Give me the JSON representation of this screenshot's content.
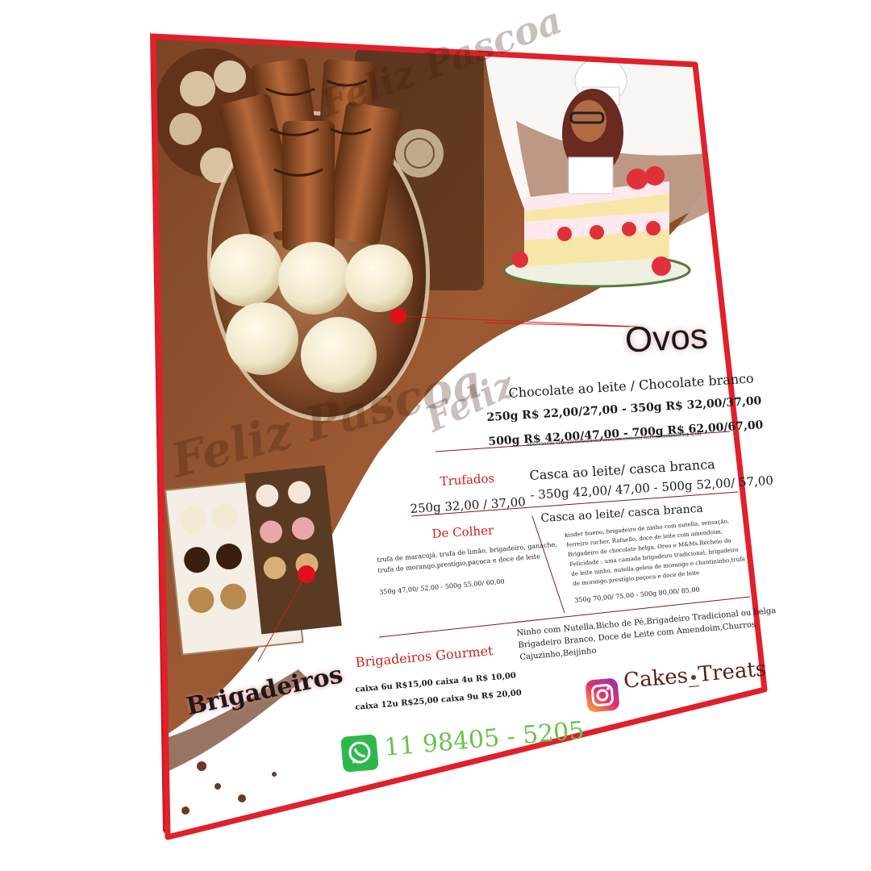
{
  "ovos": {
    "title": "Ovos",
    "subtitle": "Chocolate ao leite / Chocolate branco",
    "line1": "250g  R$ 22,00/27,00 - 350g R$ 32,00/37,00",
    "line2": "500g  R$ 42,00/47,00  - 700g R$ 62,00/67,00",
    "obs": "obs: cascas crocantes(bolacha oreo,amendoim) acrescentamos R$ 8,00"
  },
  "trufados": {
    "title": "Trufados",
    "subtitle": "Casca ao leite/ casca branca",
    "line1": "250g 32,00 / 37,00",
    "line2": "- 350g 42,00/ 47,00 - 500g 52,00/ 57,00"
  },
  "de_colher": {
    "title": "De Colher",
    "flavors": "trufa de maracujá, trufa de limão, brigadeiro, ganache,",
    "flavors2": "trufa de morango,prestígio,paçoca e doce de leite",
    "prices": "350g 47,00/ 52,00  -   500g 55,00/ 60,00"
  },
  "especial": {
    "subtitle": "Casca ao leite/ casca branca",
    "fl1": "kinder bueno, brigadeiro de ninho com nutella, sensação,",
    "fl2": "ferreiro rocher, Rafaello, doce de leite com amendoim,",
    "fl3": "Brigadeiro de chocolate belga, Oreo e M&Ms.Recheio da",
    "fl4": "Felicidade : uma camada brigadeiro tradicional, brigadeiro",
    "fl5": "de leite ninho, nutella,geleia de morango e chantininho,trufa",
    "fl6": "de morango,prestígio,paçoca e doce de leite",
    "prices": "350g 70,00/ 75,00   -   500g 80,00/ 85,00"
  },
  "brigadeiros": {
    "title": "Brigadeiros",
    "gourmet_title": "Brigadeiros Gourmet",
    "line1": "caixa 6u  R$15,00 caixa 4u R$ 10,00",
    "line2": "caixa 12u R$25,00 caixa 9u R$ 20,00",
    "flavors1": "Ninho com Nutella,Bicho de Pé,Brigadeiro Tradicional ou belga",
    "flavors2": "Brigadeiro Branco, Doce de Leite com Amendoim,Churros",
    "flavors3": "Cajuzinho,Beijinho"
  },
  "contact": {
    "phone": "11 98405 - 5205",
    "instagram": "Cakes_Treats"
  },
  "watermarks": {
    "w1": "Feliz Pascoa",
    "w2": "Feliz Pascoa",
    "w3": "Feliz"
  },
  "colors": {
    "frame": "#e0202a",
    "accent_red": "#cc1f1f",
    "chocolate": "#6b3a1f",
    "whatsapp_green": "#2fb84a",
    "phone_green": "#6ac24a",
    "instagram": "#c13584"
  },
  "icons": {
    "whatsapp": "whatsapp-icon",
    "instagram": "instagram-icon"
  }
}
